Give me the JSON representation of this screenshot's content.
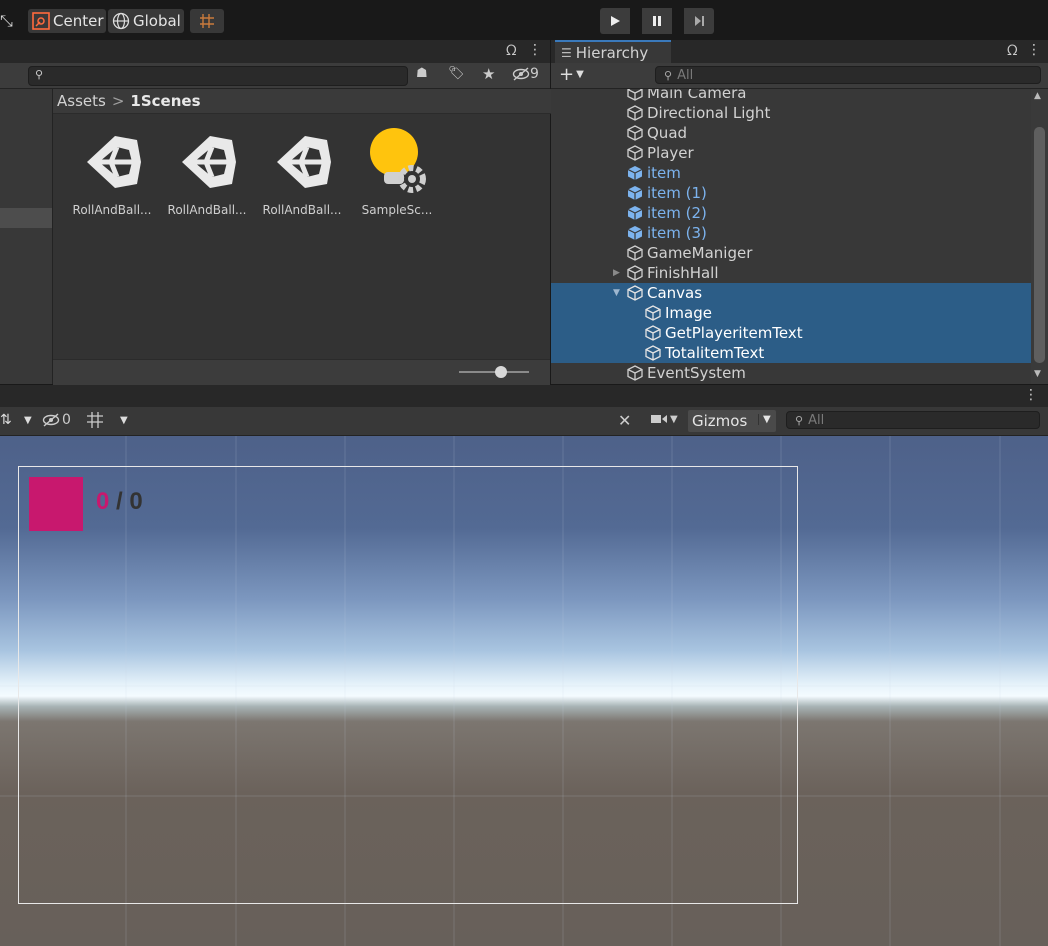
{
  "toolbar": {
    "center_label": "Center",
    "global_label": "Global"
  },
  "project": {
    "hidden_count": "9",
    "breadcrumb_root": "Assets",
    "breadcrumb_sep": ">",
    "breadcrumb_current": "1Scenes",
    "assets": [
      {
        "label": "RollAndBall..."
      },
      {
        "label": "RollAndBall..."
      },
      {
        "label": "RollAndBall..."
      },
      {
        "label": "SampleSc..."
      }
    ]
  },
  "hierarchy": {
    "tab_label": "Hierarchy",
    "search_placeholder": "All",
    "items": [
      {
        "label": "Main Camera"
      },
      {
        "label": "Directional Light"
      },
      {
        "label": "Quad"
      },
      {
        "label": "Player"
      },
      {
        "label": "item"
      },
      {
        "label": "item (1)"
      },
      {
        "label": "item (2)"
      },
      {
        "label": "item (3)"
      },
      {
        "label": "GameManiger"
      },
      {
        "label": "FinishHall"
      },
      {
        "label": "Canvas"
      },
      {
        "label": "Image"
      },
      {
        "label": "GetPlayeritemText"
      },
      {
        "label": "TotalitemText"
      },
      {
        "label": "EventSystem"
      }
    ]
  },
  "scene": {
    "hidden_count": "0",
    "gizmos_label": "Gizmos",
    "search_placeholder": "All",
    "score_current": "0",
    "score_sep": " / ",
    "score_total": "0"
  },
  "colors": {
    "selection": "#2c5d87",
    "prefab_blue": "#7cb3ee",
    "image_magenta": "#c8186e",
    "light_yellow": "#ffc40d"
  }
}
